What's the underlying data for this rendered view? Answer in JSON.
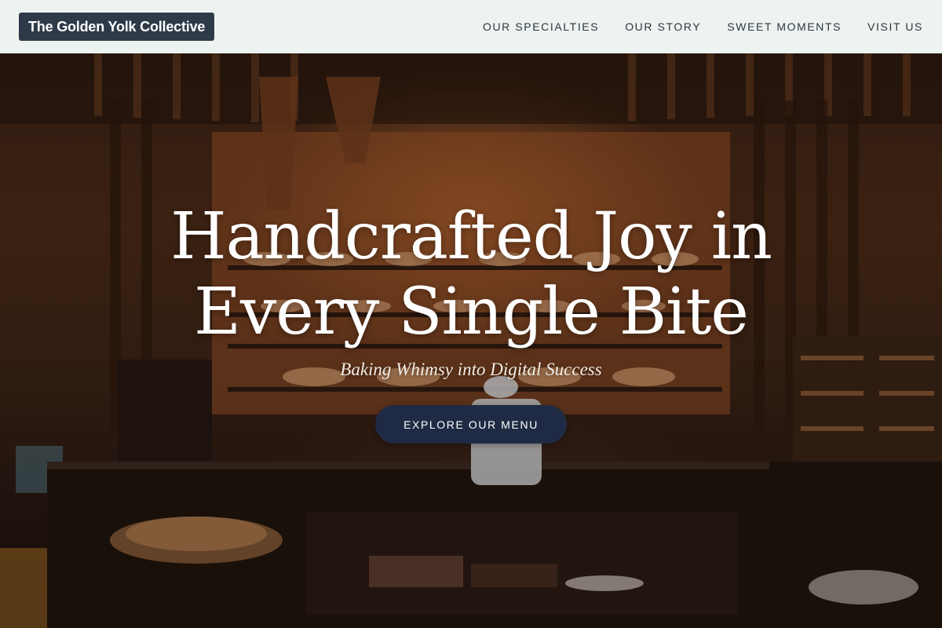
{
  "header": {
    "brand": "The Golden Yolk Collective",
    "nav": [
      "OUR SPECIALTIES",
      "OUR STORY",
      "SWEET MOMENTS",
      "VISIT US"
    ]
  },
  "hero": {
    "title": "Handcrafted Joy in Every Single Bite",
    "subtitle": "Baking Whimsy into Digital Success",
    "cta_label": "EXPLORE OUR MENU"
  },
  "colors": {
    "header_bg": "#edf3f0",
    "brand_bg": "#2e3a48",
    "nav_text": "#2d3540",
    "cta_bg": "#1f2b44",
    "hero_text": "#ffffff"
  }
}
